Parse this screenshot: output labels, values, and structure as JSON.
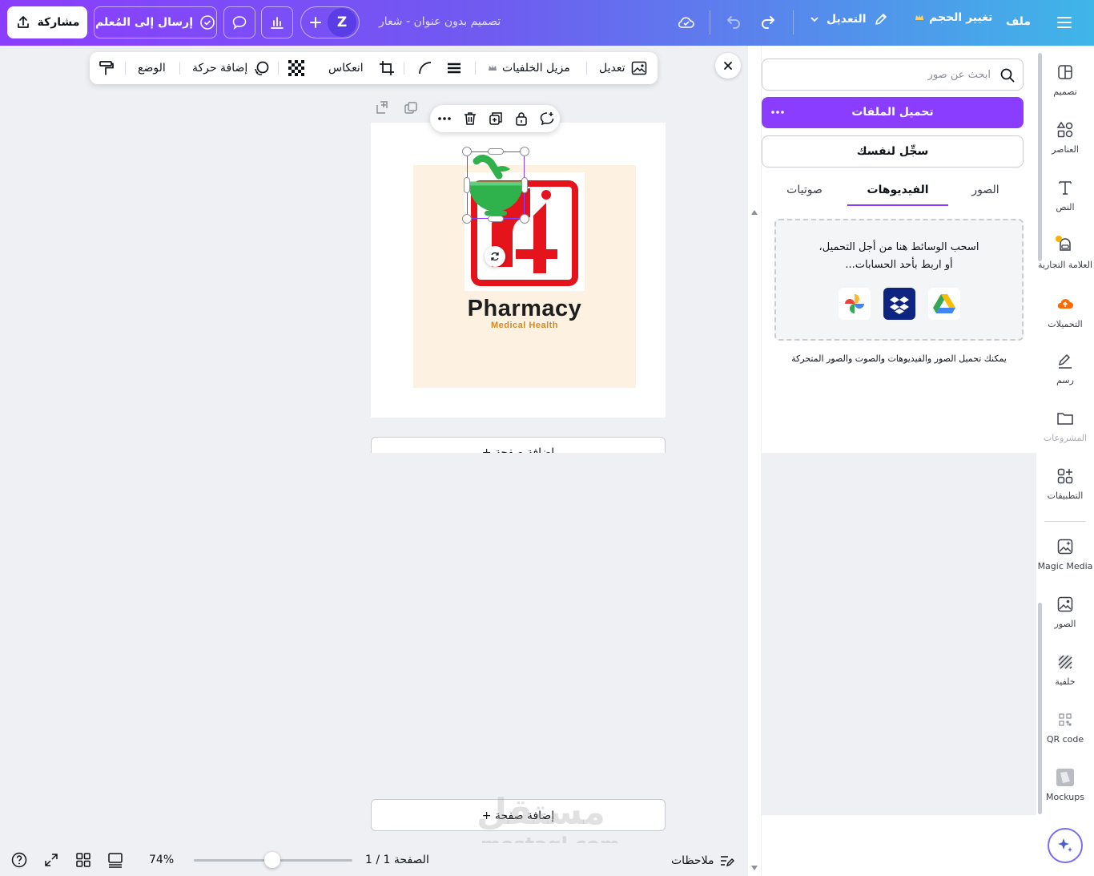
{
  "topbar": {
    "menu_label": "ملف",
    "resize_label": "تغيير الحجم",
    "edit_label": "التعديل",
    "doc_title": "تصميم بدون عنوان - شعار",
    "avatar_letter": "Z",
    "send_label": "إرسال إلى المُعلم",
    "share_label": "مشاركة"
  },
  "context_toolbar": {
    "edit_label": "تعديل",
    "bg_remover_label": "مزيل الخلفيات",
    "flip_label": "انعكاس",
    "animate_label": "إضافة حركة",
    "position_label": "الوضع"
  },
  "canvas": {
    "brand_name": "Pharmacy",
    "tagline": "Medical Health",
    "add_page_label": "+ إضافة صفحة"
  },
  "panel": {
    "search_placeholder": "ابحث عن صور",
    "upload_button": "تحميل الملفات",
    "record_button": "سجِّل لنفسك",
    "tabs": [
      "الصور",
      "الفيديوهات",
      "صوتيات"
    ],
    "active_tab": "الفيديوهات",
    "dropzone_line1": "اسحب الوسائط هنا من أجل التحميل،",
    "dropzone_line2": "أو اربط بأحد الحسابات...",
    "hint": "يمكنك تحميل الصور والفيديوهات والصوت والصور المتحركة"
  },
  "rail": [
    {
      "label": "تصميم",
      "icon": "layout-icon"
    },
    {
      "label": "العناصر",
      "icon": "shapes-icon"
    },
    {
      "label": "النص",
      "icon": "text-icon"
    },
    {
      "label": "العلامة التجارية",
      "icon": "brand-icon"
    },
    {
      "label": "التحميلات",
      "icon": "upload-cloud-icon"
    },
    {
      "label": "رسم",
      "icon": "draw-icon"
    },
    {
      "label": "المشروعات",
      "icon": "folder-icon"
    },
    {
      "label": "التطبيقات",
      "icon": "apps-icon"
    },
    {
      "label": "Magic Media",
      "icon": "magic-media-icon"
    },
    {
      "label": "الصور",
      "icon": "photos-icon"
    },
    {
      "label": "خلفية",
      "icon": "background-icon"
    },
    {
      "label": "QR code",
      "icon": "qr-icon"
    },
    {
      "label": "Mockups",
      "icon": "mockups-icon"
    }
  ],
  "bottombar": {
    "notes_label": "ملاحظات",
    "page_indicator": "الصفحة 1 / 1",
    "zoom": "74%"
  },
  "watermark": {
    "text_ar": "مستقل",
    "text_en": "mostaql.com"
  },
  "colors": {
    "brand_purple": "#8b3dff",
    "logo_red": "#e5131b",
    "logo_green": "#2fb24c",
    "tagline_gold": "#d08a2a",
    "canvas_bg": "#fdf1e1"
  }
}
